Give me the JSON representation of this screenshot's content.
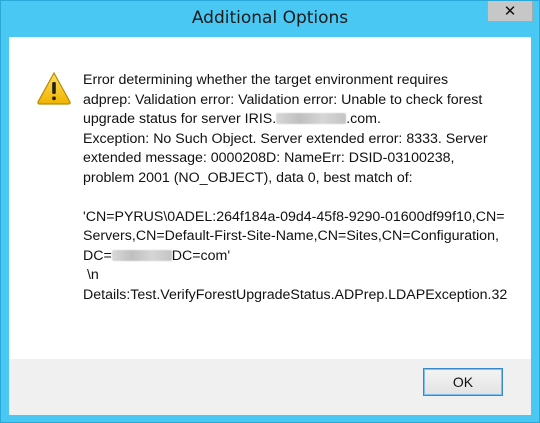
{
  "window": {
    "title": "Additional Options",
    "close_label": "✕"
  },
  "message": {
    "line1": "Error determining whether the target environment requires",
    "line2": "adprep: Validation error: Validation error: Unable to check forest",
    "line3_pre": "upgrade status for server IRIS.",
    "line3_post": ".com.",
    "line4": "Exception: No Such Object. Server extended error: 8333. Server",
    "line5": "extended message: 0000208D: NameErr: DSID-03100238,",
    "line6": "problem 2001 (NO_OBJECT), data 0, best match of:",
    "line7": "'CN=PYRUS\\0ADEL:264f184a-09d4-45f8-9290-01600df99f10,CN=",
    "line8": "Servers,CN=Default-First-Site-Name,CN=Sites,CN=Configuration,",
    "line9_pre": "DC=",
    "line9_post": "DC=com'",
    "line10": " \\n",
    "line11": "Details:Test.VerifyForestUpgradeStatus.ADPrep.LDAPException.32"
  },
  "buttons": {
    "ok_label": "OK"
  },
  "colors": {
    "frame": "#49c8f4",
    "warning_fill": "#f5c400"
  },
  "icons": {
    "warning": "warning-icon",
    "close": "close-icon"
  }
}
